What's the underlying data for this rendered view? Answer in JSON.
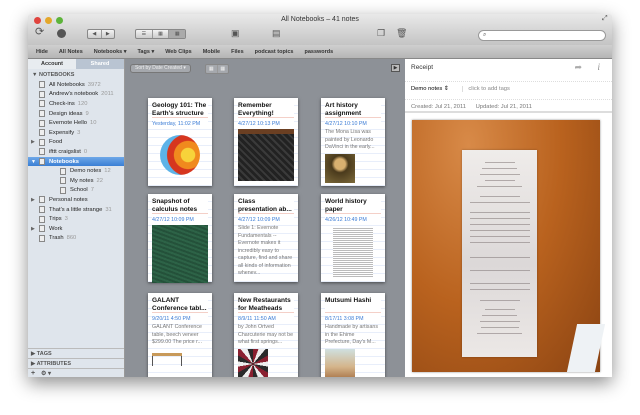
{
  "window": {
    "title": "All Notebooks – 41 notes",
    "search_placeholder": ""
  },
  "navbar": [
    "Hide",
    "All Notes",
    "Notebooks ▾",
    "Tags ▾",
    "Web Clips",
    "Mobile",
    "Files",
    "podcast topics",
    "passwords"
  ],
  "sidebar": {
    "tabs": [
      "Account",
      "Shared"
    ],
    "section": "NOTEBOOKS",
    "items": [
      {
        "label": "All Notebooks",
        "count": "3972",
        "indent": 0
      },
      {
        "label": "Andrew's notebook",
        "count": "2011",
        "indent": 0
      },
      {
        "label": "Check-ins",
        "count": "120",
        "indent": 0
      },
      {
        "label": "Design ideas",
        "count": "9",
        "indent": 0
      },
      {
        "label": "Evernote Hello",
        "count": "10",
        "indent": 0
      },
      {
        "label": "Expensify",
        "count": "3",
        "indent": 0
      },
      {
        "label": "Food",
        "count": "",
        "indent": 0,
        "arrow": "▶"
      },
      {
        "label": "ifttt craigslist",
        "count": "0",
        "indent": 0
      },
      {
        "label": "Notebooks",
        "count": "",
        "indent": 0,
        "arrow": "▼",
        "selected": true
      },
      {
        "label": "Demo notes",
        "count": "12",
        "indent": 1
      },
      {
        "label": "My notes",
        "count": "22",
        "indent": 1
      },
      {
        "label": "School",
        "count": "7",
        "indent": 1
      },
      {
        "label": "Personal notes",
        "count": "",
        "indent": 0,
        "arrow": "▶"
      },
      {
        "label": "That's a little strange",
        "count": "31",
        "indent": 0
      },
      {
        "label": "Trips",
        "count": "3",
        "indent": 0
      },
      {
        "label": "Work",
        "count": "",
        "indent": 0,
        "arrow": "▶"
      },
      {
        "label": "Trash",
        "count": "860",
        "indent": 0
      }
    ],
    "tags": "TAGS",
    "attributes": "ATTRIBUTES",
    "add": "+",
    "gear": "⚙ ▾"
  },
  "list": {
    "sort": "Sort by Date Created ▾",
    "notes": [
      {
        "title": "Geology 101: The Earth's structure",
        "date": "Yesterday, 11:02 PM",
        "snippet": "",
        "thumb": "earth"
      },
      {
        "title": "Remember Everything!",
        "date": "4/27/12 10:13 PM",
        "snippet": "",
        "thumb": "chalk"
      },
      {
        "title": "Art history assignment",
        "date": "4/27/12 10:10 PM",
        "snippet": "The Mona Lisa was painted by Leonardo DaVinci in the early...",
        "thumb": "mona"
      },
      {
        "title": "Snapshot of calculus notes",
        "date": "4/27/12 10:09 PM",
        "snippet": "",
        "thumb": "green"
      },
      {
        "title": "Class presentation ab...",
        "date": "4/27/12 10:09 PM",
        "snippet": "Slide 1: Evernote Fundamentals -- Evernote makes it incredibly easy to capture, find and share all kinds of information whenev...",
        "thumb": ""
      },
      {
        "title": "World history paper",
        "date": "4/26/12 10:49 PM",
        "snippet": "",
        "thumb": "doc"
      },
      {
        "title": "GALANT Conference tabl...",
        "date": "9/20/11 4:50 PM",
        "snippet": "GALANT Conference table, beech veneer $299.00 The price r...",
        "thumb": "table"
      },
      {
        "title": "New Restaurants for Meatheads",
        "date": "8/9/11 11:50 AM",
        "snippet": "by John Ortved Charcuterie may not be what first springs...",
        "thumb": "food"
      },
      {
        "title": "Mutsumi Hashi",
        "date": "8/17/11 3:08 PM",
        "snippet": "Handmade by artisans in the Ehime Prefecture, Day's M...",
        "thumb": "hashi"
      }
    ]
  },
  "note": {
    "title": "Receipt",
    "notebook": "Demo notes",
    "tags_placeholder": "click to add tags",
    "created": "Created: Jul 21, 2011",
    "updated": "Updated: Jul 21, 2011"
  }
}
